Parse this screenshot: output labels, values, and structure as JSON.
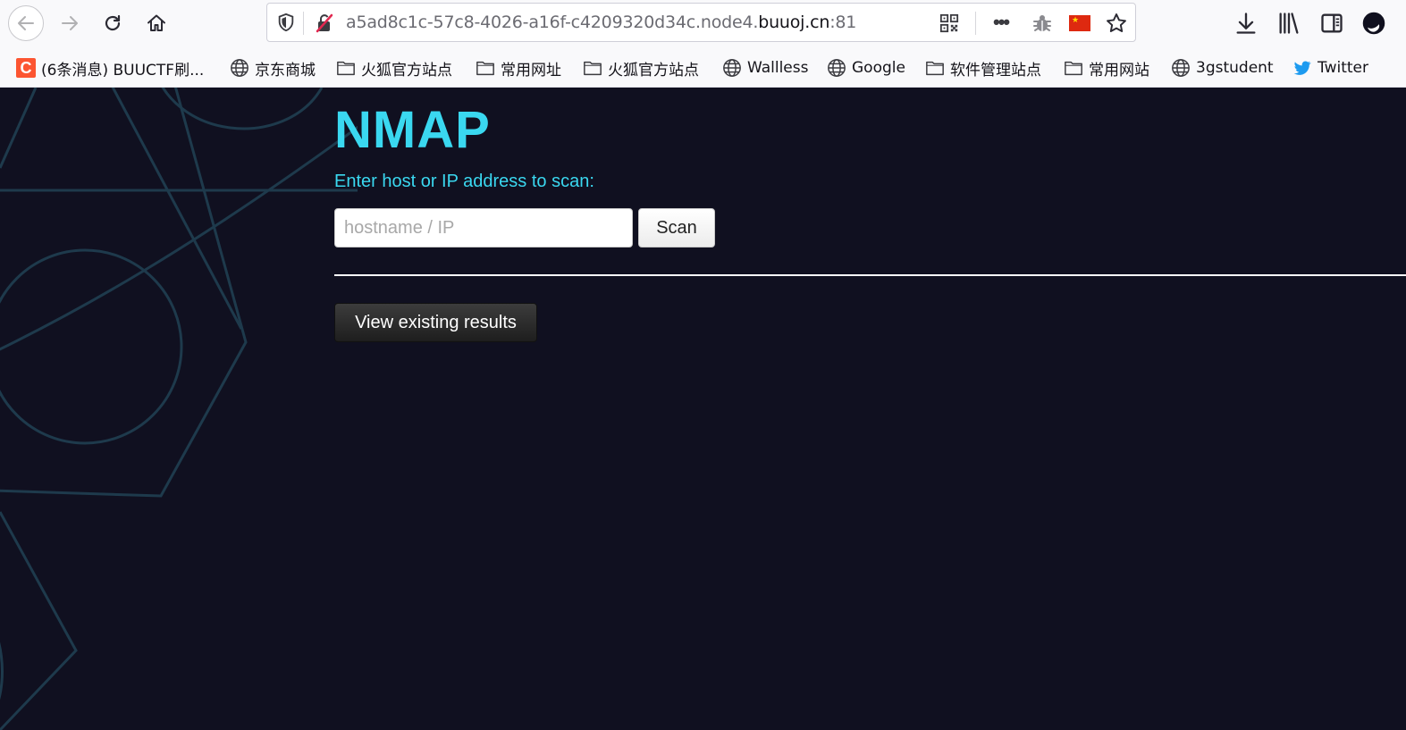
{
  "browser": {
    "url_path": "a5ad8c1c-57c8-4026-a16f-c4209320d34c.node4.",
    "url_domain": "buuoj.cn",
    "url_port": ":81",
    "bookmarks": [
      {
        "icon": "csdn-icon",
        "label": "(6条消息) BUUCTF刷..."
      },
      {
        "icon": "globe-icon",
        "label": "京东商城"
      },
      {
        "icon": "folder-icon",
        "label": "火狐官方站点"
      },
      {
        "icon": "folder-icon",
        "label": "常用网址"
      },
      {
        "icon": "folder-icon",
        "label": "火狐官方站点"
      },
      {
        "icon": "globe-icon",
        "label": "Wallless"
      },
      {
        "icon": "globe-icon",
        "label": "Google"
      },
      {
        "icon": "folder-icon",
        "label": "软件管理站点"
      },
      {
        "icon": "folder-icon",
        "label": "常用网站"
      },
      {
        "icon": "globe-icon",
        "label": "3gstudent"
      },
      {
        "icon": "twitter-icon",
        "label": "Twitter"
      }
    ]
  },
  "page": {
    "title": "NMAP",
    "prompt": "Enter host or IP address to scan:",
    "input_placeholder": "hostname / IP",
    "input_value": "",
    "scan_label": "Scan",
    "view_results_label": "View existing results"
  },
  "colors": {
    "page_background": "#101020",
    "accent": "#3ad8f0"
  }
}
